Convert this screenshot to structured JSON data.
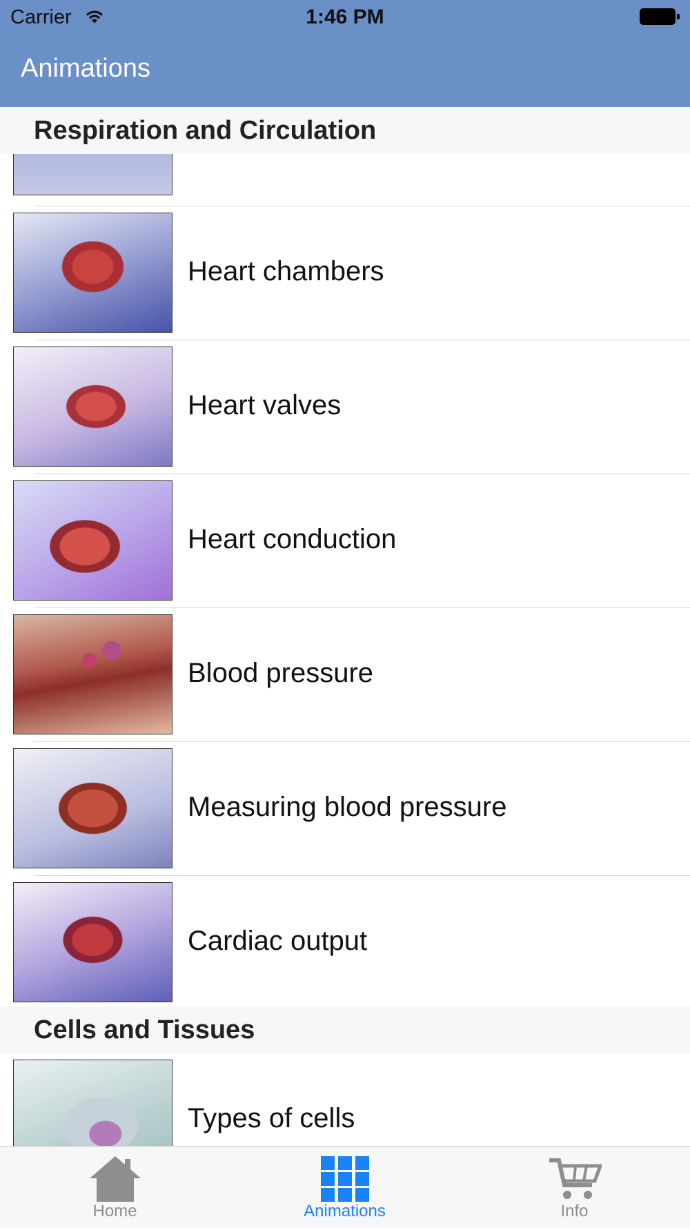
{
  "status_bar": {
    "carrier": "Carrier",
    "time": "1:46 PM"
  },
  "nav": {
    "title": "Animations"
  },
  "sections": [
    {
      "title": "Respiration and Circulation",
      "items": [
        {
          "label": "Heart chambers",
          "thumb": "heart-chambers-image"
        },
        {
          "label": "Heart valves",
          "thumb": "heart-valves-image"
        },
        {
          "label": "Heart conduction",
          "thumb": "heart-conduction-image"
        },
        {
          "label": "Blood pressure",
          "thumb": "blood-pressure-image"
        },
        {
          "label": "Measuring blood pressure",
          "thumb": "measuring-blood-pressure-image"
        },
        {
          "label": "Cardiac output",
          "thumb": "cardiac-output-image"
        }
      ]
    },
    {
      "title": "Cells and Tissues",
      "items": [
        {
          "label": "Types of cells",
          "thumb": "types-of-cells-image"
        }
      ]
    }
  ],
  "tab_bar": {
    "items": [
      {
        "label": "Home",
        "icon": "home-icon",
        "selected": false
      },
      {
        "label": "Animations",
        "icon": "grid-icon",
        "selected": true
      },
      {
        "label": "Info",
        "icon": "cart-icon",
        "selected": false
      }
    ],
    "active_color": "#1a82f7",
    "inactive_color": "#8e8e8e"
  },
  "colors": {
    "nav_bar": "#6b90c7",
    "section_header_bg": "#f7f7f7"
  }
}
